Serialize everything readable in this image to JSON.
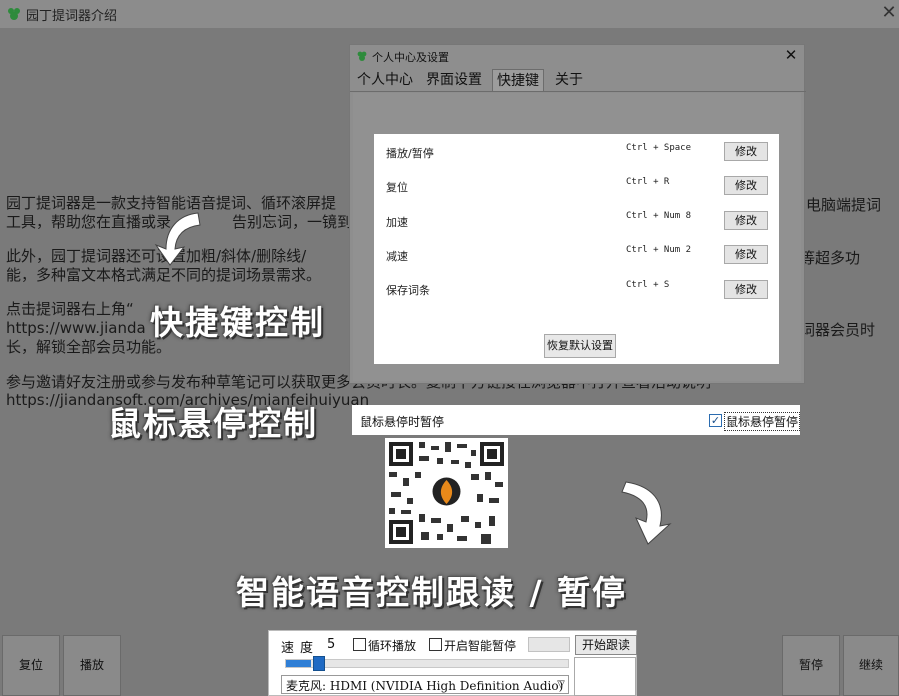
{
  "window": {
    "title": "园丁提词器介绍",
    "close": "✕"
  },
  "intro": {
    "line1": "园丁提词器是一款支持智能语音提词、循环滚屏提",
    "line1_right": "电脑端提词",
    "line2": "工具，帮助您在直播或录",
    "line2_mid": "告别忘词，一镜到底",
    "line3": "此外，园丁提词器还可设置加粗/斜体/删除线/",
    "line3_right": "等超多功",
    "line4": "能，多种富文本格式满足不同的提词场景需求。",
    "line5": "点击提词器右上角“",
    "line6": " https://www.jianda",
    "line6_right": "词器会员时",
    "line7": "长，解锁全部会员功能。",
    "line8": "参与邀请好友注册或参与发布种草笔记可以获取更多会员时长。复制下方链接在浏览器中打开查看活动说明",
    "line9": "https://jiandansoft.com/archives/mianfeihuiyuan"
  },
  "dialog": {
    "title": "个人中心及设置",
    "close": "✕",
    "tabs": [
      {
        "label": "个人中心"
      },
      {
        "label": "界面设置"
      },
      {
        "label": "快捷键"
      },
      {
        "label": "关于"
      }
    ],
    "active_tab": "快捷键"
  },
  "shortcuts": {
    "rows": [
      {
        "label": "播放/暂停",
        "key": "Ctrl + Space",
        "button": "修改"
      },
      {
        "label": "复位",
        "key": "Ctrl + R",
        "button": "修改"
      },
      {
        "label": "加速",
        "key": "Ctrl + Num 8",
        "button": "修改"
      },
      {
        "label": "减速",
        "key": "Ctrl + Num 2",
        "button": "修改"
      },
      {
        "label": "保存词条",
        "key": "Ctrl + S",
        "button": "修改"
      }
    ],
    "reset_button": "恢复默认设置"
  },
  "hover": {
    "label": "鼠标悬停时暂停",
    "checkbox_label": "鼠标悬停暂停",
    "checked": true,
    "check_glyph": "✓"
  },
  "captions": {
    "shortcut": "快捷键控制",
    "hover": "鼠标悬停控制",
    "voice": "智能语音控制跟读 / 暂停"
  },
  "bottom_buttons": {
    "reset": "复位",
    "play": "播放",
    "pause": "暂停",
    "resume": "继续"
  },
  "control": {
    "speed_label": "速度",
    "speed_value": "5",
    "loop_label": "循环播放",
    "smart_pause_label": "开启智能暂停",
    "start_button": "开始跟读",
    "slider_fraction": 0.09,
    "mic_label": "麦克风: HDMI (NVIDIA High Definition Audio)",
    "mic_arrow": "▽"
  },
  "colors": {
    "accent_blue": "#2f7fd6",
    "app_icon_green": "#2e8b3c"
  },
  "icons": {
    "app": "leaf-icon",
    "dialog": "leaf-icon"
  }
}
